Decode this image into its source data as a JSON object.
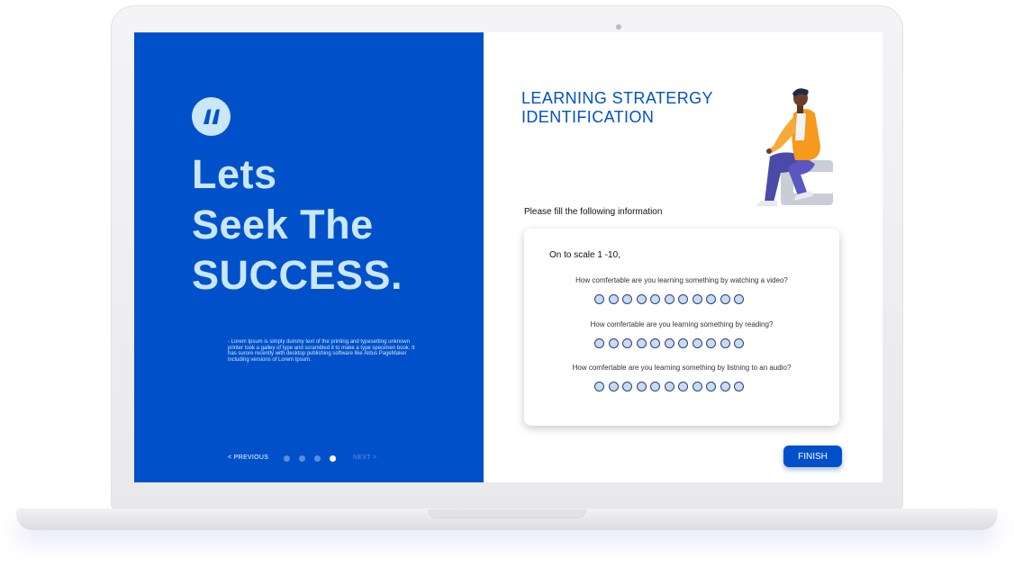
{
  "colors": {
    "primary": "#0051c9",
    "headline": "#c9e6fb",
    "radio_fill": "#c7dcf3",
    "radio_border": "#2b3f7a"
  },
  "left": {
    "quote_icon": "quote-icon",
    "headline": [
      "Lets",
      "Seek The",
      "SUCCESS."
    ],
    "lorem": "- Lorem Ipsum is simply dummy text of the printing and typesetting unknown printer took a galley of type and scrambled it to make a type specimen book. It has surore recently with desktop publishing software like Aldus PageMaker including versions of Lorem Ipsum.",
    "pager": {
      "prev_label": "< PREVIOUS",
      "next_label": "NEXT >",
      "dot_count": 4,
      "active_dot": 4
    }
  },
  "right": {
    "title": [
      "LEARNING STRATERGY",
      "IDENTIFICATION"
    ],
    "instruction": "Please fill the following information",
    "card": {
      "scale_title": "On to scale 1 -10,",
      "questions": [
        {
          "text": "How comfertable are you learning something by watching a video?",
          "options": 11
        },
        {
          "text": "How comfertable are you learning something by reading?",
          "options": 11
        },
        {
          "text": "How comfertable are you learning something by listning to an audio?",
          "options": 11
        }
      ]
    },
    "finish_label": "FINISH"
  }
}
